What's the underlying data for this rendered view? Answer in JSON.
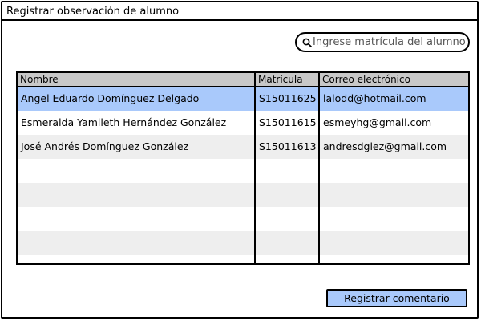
{
  "window": {
    "title": "Registrar observación de alumno"
  },
  "search": {
    "icon": "search-icon",
    "value": "",
    "placeholder": "Ingrese matrícula del alumno"
  },
  "table": {
    "columns": [
      "Nombre",
      "Matrícula",
      "Correo electrónico"
    ],
    "rows": [
      [
        "Angel Eduardo Domínguez Delgado",
        "S15011625",
        "lalodd@hotmail.com"
      ],
      [
        "Esmeralda Yamileth Hernández González",
        "S15011615",
        "esmeyhg@gmail.com"
      ],
      [
        "José Andrés Domínguez González",
        "S15011613",
        "andresdglez@gmail.com"
      ]
    ],
    "selected_row": 0
  },
  "actions": {
    "register_comment_label": "Registrar comentario"
  },
  "colors": {
    "selection": "#a9c9fb",
    "header": "#c8c8c8",
    "stripe": "#eeeeee",
    "button": "#a9c9fb",
    "border": "#000000"
  }
}
